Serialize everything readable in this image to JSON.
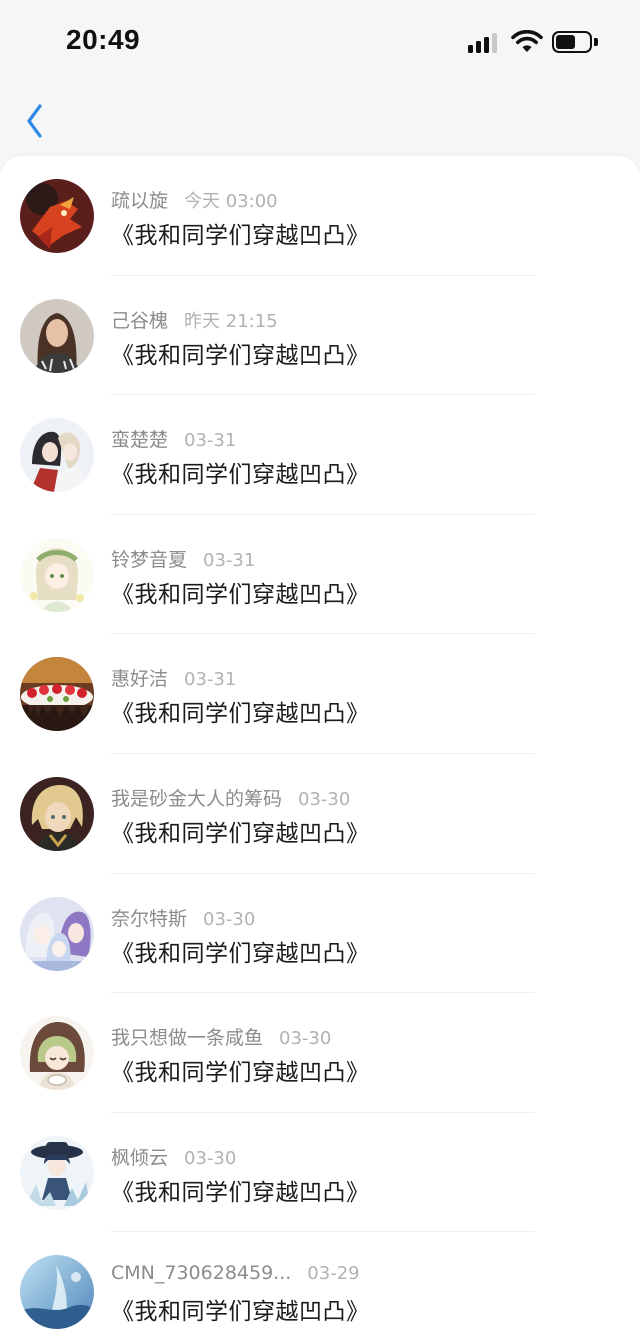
{
  "status_bar": {
    "time": "20:49",
    "signal_icon": "cellular-signal-icon",
    "wifi_icon": "wifi-icon",
    "battery_icon": "battery-icon",
    "battery_level": 0.6
  },
  "nav": {
    "back_icon": "chevron-left-icon",
    "accent": "#2e8ae6"
  },
  "messages": [
    {
      "name": "疏以旋",
      "time": "今天 03:00",
      "text": "《我和同学们穿越凹凸》"
    },
    {
      "name": "己谷槐",
      "time": "昨天 21:15",
      "text": "《我和同学们穿越凹凸》"
    },
    {
      "name": "蛮楚楚",
      "time": "03-31",
      "text": "《我和同学们穿越凹凸》"
    },
    {
      "name": "铃梦音夏",
      "time": "03-31",
      "text": "《我和同学们穿越凹凸》"
    },
    {
      "name": "惠好洁",
      "time": "03-31",
      "text": "《我和同学们穿越凹凸》"
    },
    {
      "name": "我是砂金大人的筹码",
      "time": "03-30",
      "text": "《我和同学们穿越凹凸》"
    },
    {
      "name": "奈尔特斯",
      "time": "03-30",
      "text": "《我和同学们穿越凹凸》"
    },
    {
      "name": "我只想做一条咸鱼",
      "time": "03-30",
      "text": "《我和同学们穿越凹凸》"
    },
    {
      "name": "枫倾云",
      "time": "03-30",
      "text": "《我和同学们穿越凹凸》"
    },
    {
      "name": "CMN_730628459...",
      "time": "03-29",
      "text": "《我和同学们穿越凹凸》"
    }
  ]
}
